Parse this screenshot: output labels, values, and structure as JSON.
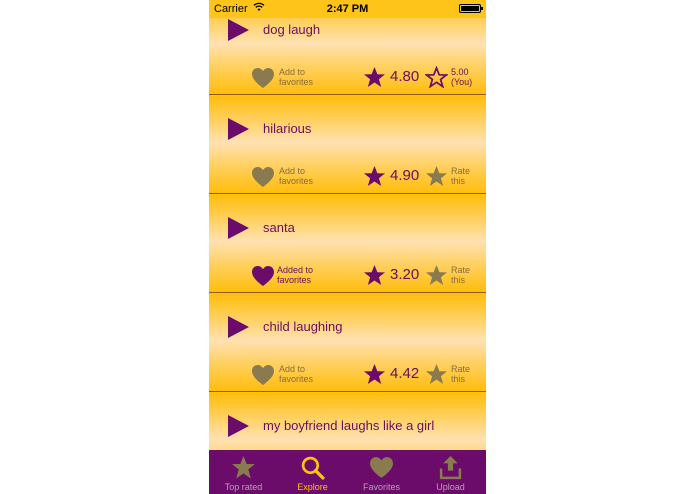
{
  "status_bar": {
    "carrier": "Carrier",
    "time": "2:47 PM"
  },
  "colors": {
    "accent": "#6b0c5c",
    "background": "#ffc20e",
    "tab_bar": "#6b0c6b",
    "inactive": "#8a7a50"
  },
  "rows": [
    {
      "title": "dog laugh",
      "favorite": false,
      "fav_label": "Add to favorites",
      "score": "4.80",
      "rate_label": "5.00 (You)",
      "rated": true
    },
    {
      "title": "hilarious",
      "favorite": false,
      "fav_label": "Add to favorites",
      "score": "4.90",
      "rate_label": "Rate this",
      "rated": false
    },
    {
      "title": "santa",
      "favorite": true,
      "fav_label": "Added to favorites",
      "score": "3.20",
      "rate_label": "Rate this",
      "rated": false
    },
    {
      "title": "child laughing",
      "favorite": false,
      "fav_label": "Add to favorites",
      "score": "4.42",
      "rate_label": "Rate this",
      "rated": false
    },
    {
      "title": "my boyfriend laughs like a girl"
    }
  ],
  "tabs": [
    {
      "label": "Top rated",
      "icon": "star-icon",
      "active": false
    },
    {
      "label": "Explore",
      "icon": "magnifier-icon",
      "active": true
    },
    {
      "label": "Favorites",
      "icon": "heart-icon",
      "active": false
    },
    {
      "label": "Upload",
      "icon": "upload-icon",
      "active": false
    }
  ]
}
